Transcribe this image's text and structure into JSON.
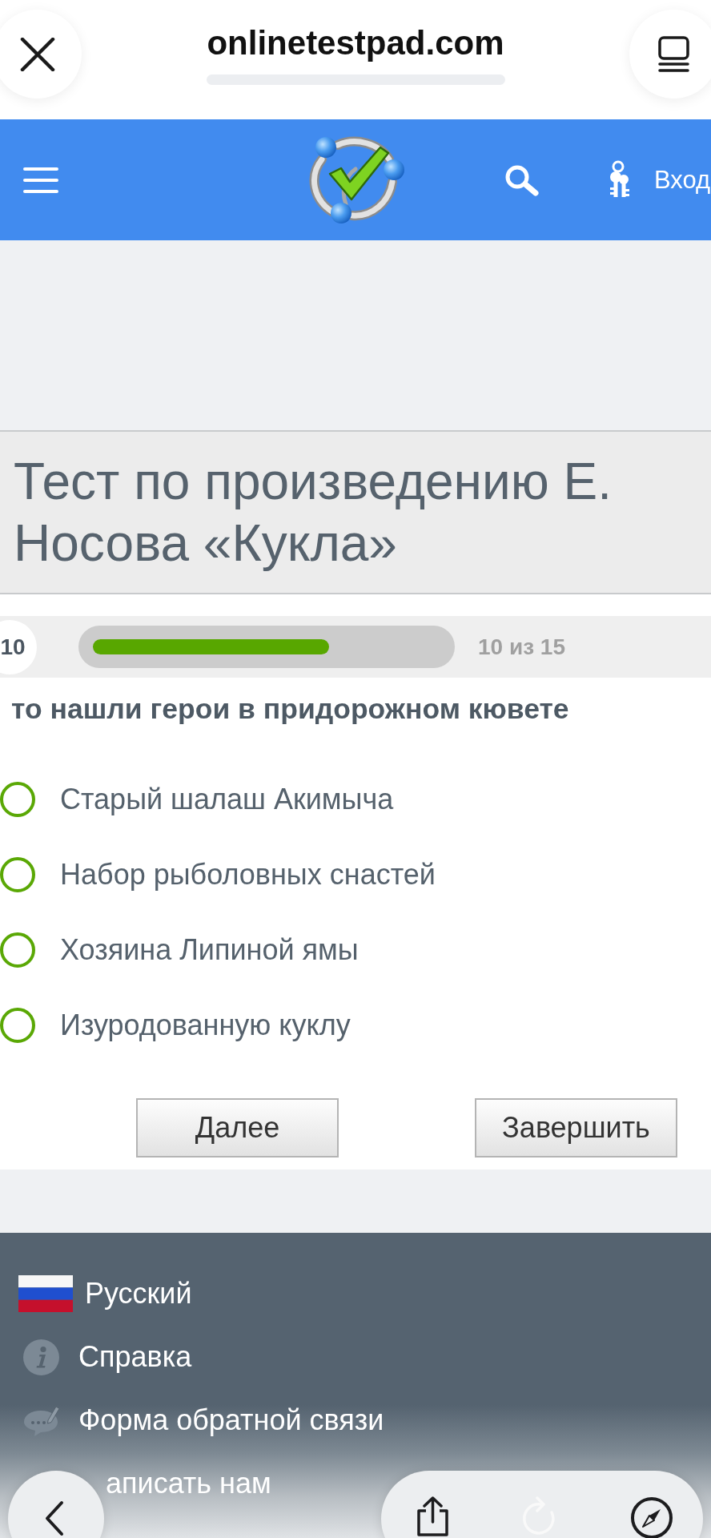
{
  "browser": {
    "address": "onlinetestpad.com"
  },
  "header": {
    "login": "Вход"
  },
  "test": {
    "title": "Тест по произведению Е. Носова «Кукла»",
    "question_number": "10",
    "progress": {
      "level": 0.667,
      "reading": "10 из 15"
    },
    "question": "то нашли герои в придорожном кювете",
    "options": [
      {
        "label": "Старый шалаш Акимыча",
        "selected": false
      },
      {
        "label": "Набор рыболовных снастей",
        "selected": false
      },
      {
        "label": "Хозяина Липиной ямы",
        "selected": false
      },
      {
        "label": "Изуродованную куклу",
        "selected": false
      }
    ],
    "buttons": [
      "Далее",
      "Завершить"
    ]
  },
  "footer": {
    "links": [
      {
        "kind": "language",
        "label": "Русский"
      },
      {
        "kind": "help",
        "label": "Справка"
      },
      {
        "kind": "feedback",
        "label": "Форма обратной связи"
      },
      {
        "kind": "contact",
        "label": "аписать нам"
      }
    ]
  }
}
